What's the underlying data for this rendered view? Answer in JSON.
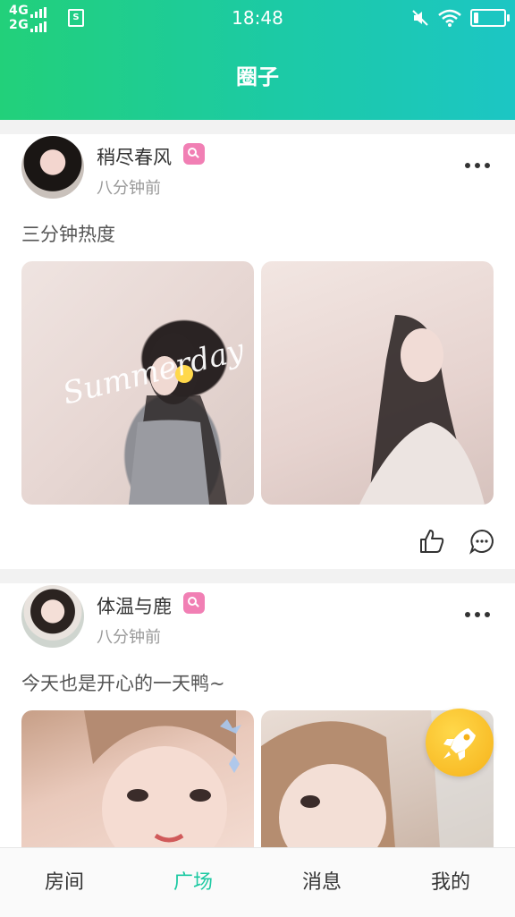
{
  "status_bar": {
    "net1": "4G",
    "net2": "2G",
    "sim_label": "S",
    "time": "18:48",
    "battery_level": 0.18,
    "icons": [
      "mute-icon",
      "wifi-icon",
      "battery-icon"
    ]
  },
  "header": {
    "title": "圈子"
  },
  "posts": [
    {
      "username": "稍尽春风",
      "time": "八分钟前",
      "text": "三分钟热度",
      "photo_1_caption": "Summerday"
    },
    {
      "username": "体温与鹿",
      "time": "八分钟前",
      "text": "今天也是开心的一天鸭~"
    }
  ],
  "nav": {
    "tabs": [
      {
        "label": "房间"
      },
      {
        "label": "广场"
      },
      {
        "label": "消息"
      },
      {
        "label": "我的"
      }
    ],
    "active_index": 1
  },
  "colors": {
    "header_start": "#22d07a",
    "header_end": "#1cc6c4",
    "accent": "#1cc9a2",
    "badge": "#f17fb4",
    "fab": "#f6b21a"
  }
}
